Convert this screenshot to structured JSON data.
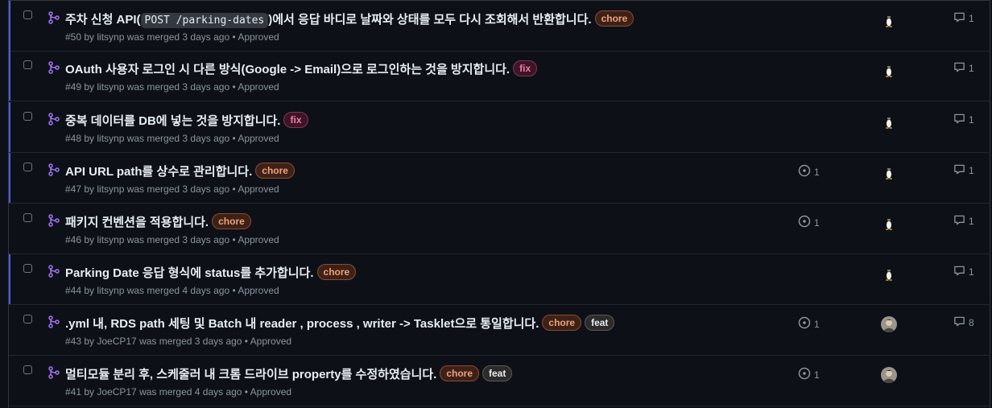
{
  "pull_requests": [
    {
      "title_pre": "주차 신청 API(",
      "title_code": "POST /parking-dates",
      "title_post": ")에서 응답 바디로 날짜와 상태를 모두 다시 조회해서 반환합니다.",
      "labels": [
        "chore"
      ],
      "meta": "#50 by litsynp was merged 3 days ago • Approved",
      "reviews": "",
      "comments": "1",
      "avatar": "tux",
      "unread": true
    },
    {
      "title": "OAuth 사용자 로그인 시 다른 방식(Google -> Email)으로 로그인하는 것을 방지합니다.",
      "labels": [
        "fix"
      ],
      "meta": "#49 by litsynp was merged 3 days ago • Approved",
      "reviews": "",
      "comments": "1",
      "avatar": "tux",
      "unread": true
    },
    {
      "title": "중복 데이터를 DB에 넣는 것을 방지합니다.",
      "labels": [
        "fix"
      ],
      "meta": "#48 by litsynp was merged 3 days ago • Approved",
      "reviews": "",
      "comments": "1",
      "avatar": "tux",
      "unread": true
    },
    {
      "title": "API URL path를 상수로 관리합니다.",
      "labels": [
        "chore"
      ],
      "meta": "#47 by litsynp was merged 3 days ago • Approved",
      "reviews": "1",
      "comments": "1",
      "avatar": "tux",
      "unread": true
    },
    {
      "title": "패키지 컨벤션을 적용합니다.",
      "labels": [
        "chore"
      ],
      "meta": "#46 by litsynp was merged 3 days ago • Approved",
      "reviews": "1",
      "comments": "1",
      "avatar": "tux",
      "unread": false
    },
    {
      "title": "Parking Date 응답 형식에 status를 추가합니다.",
      "labels": [
        "chore"
      ],
      "meta": "#44 by litsynp was merged 4 days ago • Approved",
      "reviews": "",
      "comments": "1",
      "avatar": "tux",
      "unread": true
    },
    {
      "title": ".yml 내, RDS path 세팅 및 Batch 내 reader , process , writer -> Tasklet으로 통일합니다.",
      "labels": [
        "chore",
        "feat"
      ],
      "meta": "#43 by JoeCP17 was merged 3 days ago • Approved",
      "reviews": "1",
      "comments": "8",
      "avatar": "photo",
      "unread": false
    },
    {
      "title": "멀티모듈 분리 후, 스케줄러 내 크롬 드라이브 property를 수정하였습니다.",
      "labels": [
        "chore",
        "feat"
      ],
      "meta": "#41 by JoeCP17 was merged 4 days ago • Approved",
      "reviews": "1",
      "comments": "",
      "avatar": "photo",
      "unread": false
    }
  ],
  "icons": {
    "pr": "git-merge-icon",
    "review": "review-dot-icon",
    "comment": "comment-icon"
  },
  "colors": {
    "merged": "#a371f7",
    "unread_bar": "#4f5ce0"
  }
}
